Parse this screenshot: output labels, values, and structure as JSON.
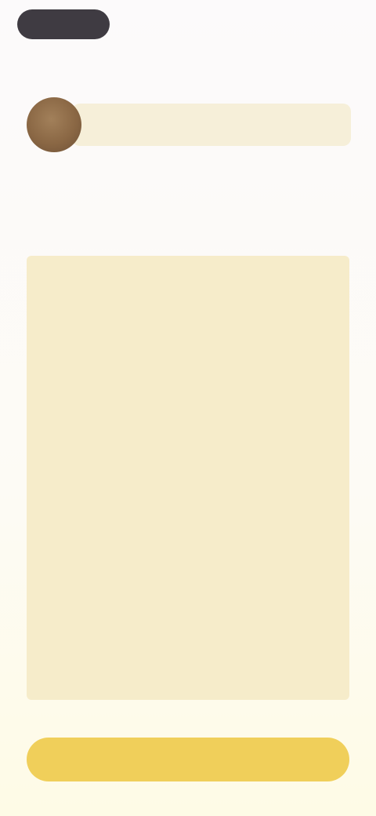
{
  "topbar": {
    "back_label": "",
    "action_label": ""
  },
  "profile": {
    "kicker": "",
    "name": "",
    "meta": ""
  },
  "steps_section": {
    "title": "",
    "steps": [
      {
        "number": "",
        "text": ""
      },
      {
        "number": "",
        "text": ""
      },
      {
        "number": "",
        "text": ""
      },
      {
        "number": "",
        "text": ""
      }
    ]
  },
  "footer": {
    "primary_label": ""
  },
  "colors": {
    "accent": "#f0cf5a",
    "panel": "#f6ecca",
    "pill": "#3f3b42"
  }
}
